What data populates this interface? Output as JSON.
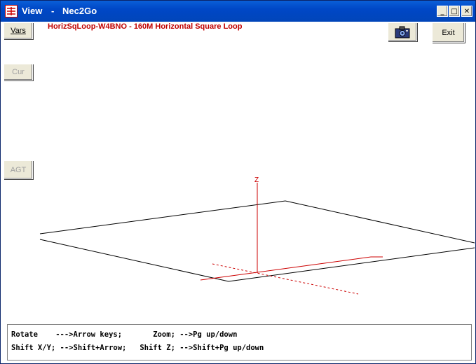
{
  "window": {
    "title": "View",
    "separator": "-",
    "app_name": "Nec2Go",
    "controls": {
      "minimize": "_",
      "maximize": "□",
      "close": "✕"
    }
  },
  "toolbar": {
    "vars_label": "Vars",
    "cur_label": "Cur",
    "agt_label": "AGT",
    "exit_label": "Exit",
    "camera_icon": "camera-icon"
  },
  "heading": "HorizSqLoop-W4BNO - 160M Horizontal Square Loop",
  "viewport": {
    "z_axis_label": "Z",
    "colors": {
      "model": "#000000",
      "axes": "#cc0000"
    }
  },
  "help": {
    "line1": "Rotate    --->Arrow keys;       Zoom; -->Pg up/down",
    "line2": "Shift X/Y; -->Shift+Arrow;   Shift Z; -->Shift+Pg up/down"
  }
}
